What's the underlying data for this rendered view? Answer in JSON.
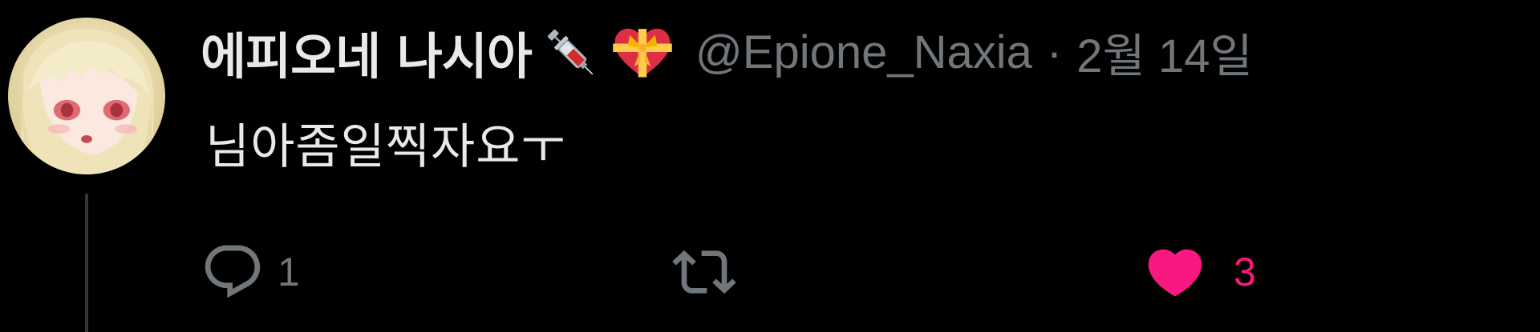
{
  "tweet": {
    "display_name": "에피오네 나시아",
    "name_emojis": [
      "syringe-icon",
      "heart-with-ribbon-icon"
    ],
    "handle": "@Epione_Naxia",
    "separator": "·",
    "date": "2월 14일",
    "text": "님아좀일찍자요ㅜ",
    "reply_count": "1",
    "like_count": "3",
    "liked": true
  },
  "colors": {
    "background": "#000000",
    "primary_text": "#e7e9ea",
    "secondary_text": "#71767b",
    "like": "#f91880",
    "thread_line": "#333639"
  }
}
